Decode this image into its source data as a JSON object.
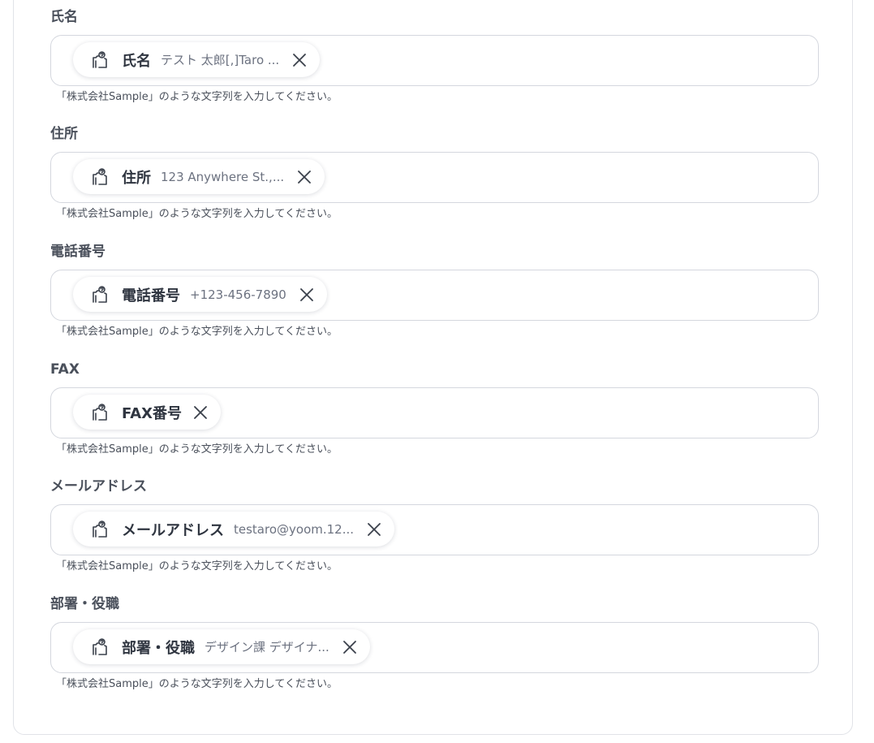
{
  "fields": [
    {
      "label": "氏名",
      "chip_name": "氏名",
      "chip_value": "テスト 太郎[,]Taro ...",
      "hint": "「株式会社Sample」のような文字列を入力してください。"
    },
    {
      "label": "住所",
      "chip_name": "住所",
      "chip_value": "123 Anywhere St.,...",
      "hint": "「株式会社Sample」のような文字列を入力してください。"
    },
    {
      "label": "電話番号",
      "chip_name": "電話番号",
      "chip_value": "+123-456-7890",
      "hint": "「株式会社Sample」のような文字列を入力してください。"
    },
    {
      "label": "FAX",
      "chip_name": "FAX番号",
      "chip_value": "",
      "hint": "「株式会社Sample」のような文字列を入力してください。"
    },
    {
      "label": "メールアドレス",
      "chip_name": "メールアドレス",
      "chip_value": "testaro@yoom.12...",
      "hint": "「株式会社Sample」のような文字列を入力してください。"
    },
    {
      "label": "部署・役職",
      "chip_name": "部署・役職",
      "chip_value": "デザイン課 デザイナ...",
      "hint": "「株式会社Sample」のような文字列を入力してください。"
    }
  ],
  "icons": {
    "chip_icon": "hand-pointer-icon",
    "close_icon": "close-icon"
  },
  "colors": {
    "label": "#4a505b",
    "border": "#d4d7de",
    "chip_text": "#2f3540",
    "chip_value": "#6c7280"
  }
}
